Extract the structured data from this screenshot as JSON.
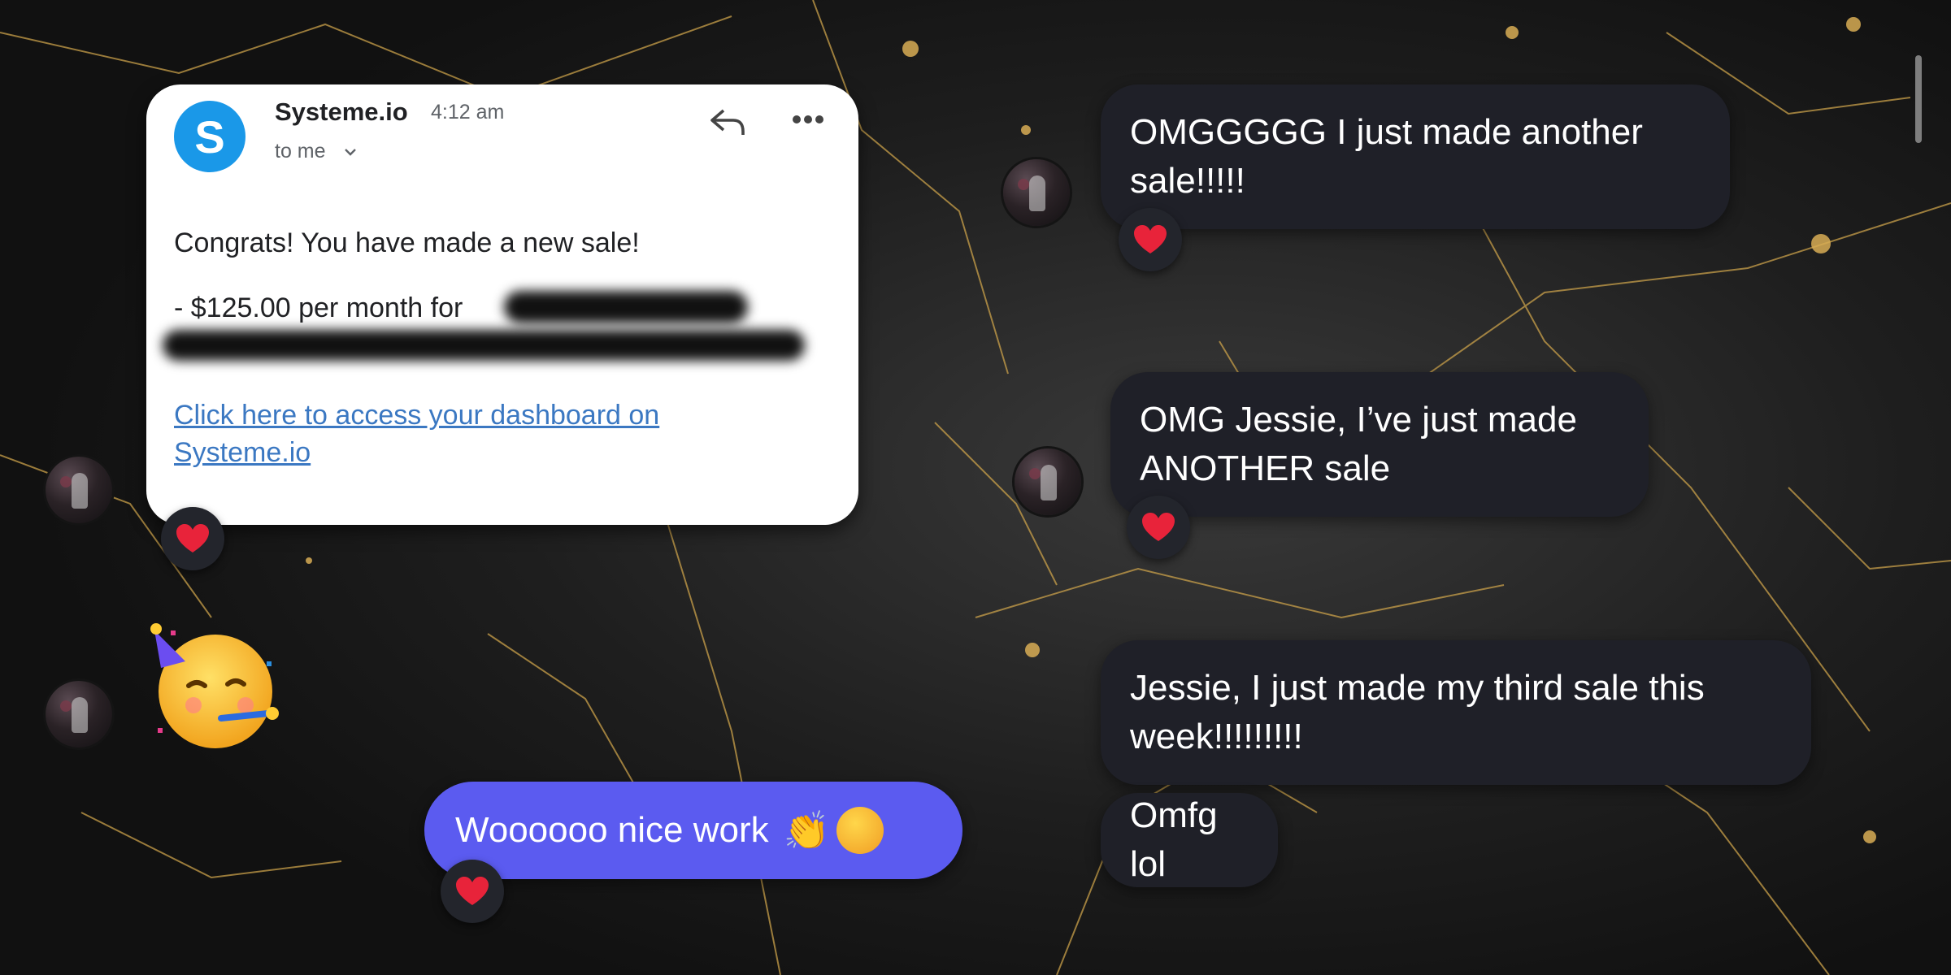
{
  "email": {
    "sender": "Systeme.io",
    "logo_letter": "S",
    "time": "4:12 am",
    "to_me": "to me",
    "line1": "Congrats! You have made a new sale!",
    "line2": "- $125.00 per month for",
    "link": "Click here to access your dashboard on Systeme.io"
  },
  "messages_right": [
    {
      "text": "OMGGGGG I just made another sale!!!!!",
      "reaction": "heart"
    },
    {
      "text": "OMG Jessie, I’ve just made ANOTHER sale",
      "reaction": "heart"
    },
    {
      "text": "Jessie, I just made my third sale this week!!!!!!!!!"
    },
    {
      "text": "Omfg lol"
    }
  ],
  "reply": {
    "text": "Woooooo nice work",
    "emoji": "👏",
    "reaction": "heart"
  },
  "colors": {
    "bubble_dark": "#1f2028",
    "bubble_blue": "#5b5bf0",
    "heart": "#e8233a",
    "link": "#3b78c2",
    "logo": "#1a98e8"
  },
  "icons": [
    "reply-icon",
    "more-icon",
    "chevron-down-icon",
    "heart-icon",
    "partying-face-icon",
    "clapping-hands-icon"
  ]
}
